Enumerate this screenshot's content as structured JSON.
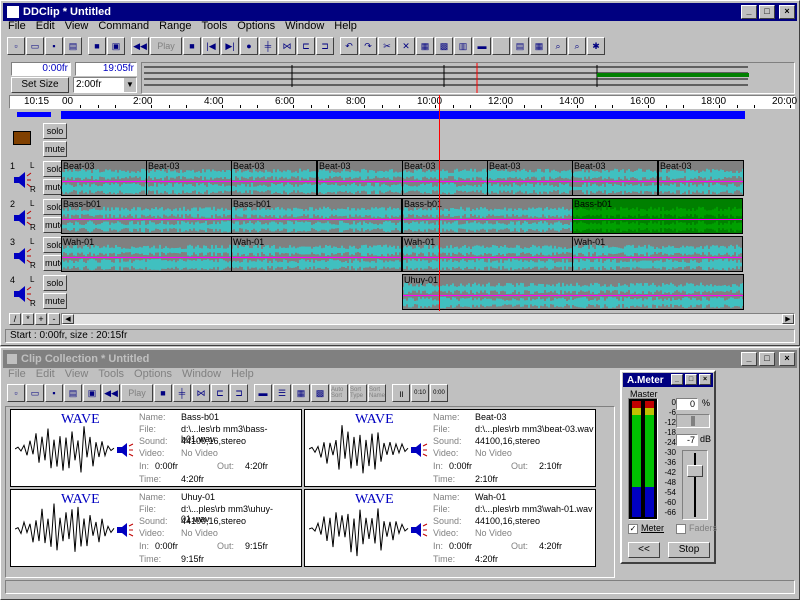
{
  "main": {
    "title": "DDClip * Untitled",
    "menus": [
      "File",
      "Edit",
      "View",
      "Command",
      "Range",
      "Tools",
      "Options",
      "Window",
      "Help"
    ],
    "play_label": "Play",
    "pos_start": "0:00fr",
    "pos_end": "19:05fr",
    "set_size_label": "Set Size",
    "size_value": "2:00fr",
    "current_time": "10:15",
    "ruler_ticks": [
      "00",
      "2:00",
      "4:00",
      "6:00",
      "8:00",
      "10:00",
      "12:00",
      "14:00",
      "16:00",
      "18:00",
      "20:00"
    ],
    "tracks": [
      {
        "num": "1",
        "solo": "solo",
        "mute": "mute",
        "clips": [
          "Beat-03",
          "Beat-03",
          "Beat-03",
          "Beat-03",
          "Beat-03",
          "Beat-03",
          "Beat-03",
          "Beat-03"
        ]
      },
      {
        "num": "2",
        "solo": "solo",
        "mute": "mute",
        "clips": [
          "Bass-b01",
          "Bass-b01",
          "Bass-b01",
          "Bass-b01"
        ]
      },
      {
        "num": "3",
        "solo": "solo",
        "mute": "mute",
        "clips": [
          "Wah-01",
          "Wah-01",
          "Wah-01",
          "Wah-01"
        ]
      },
      {
        "num": "4",
        "solo": "solo",
        "mute": "mute",
        "clips": [
          "Uhuy-01"
        ]
      }
    ],
    "video_track": {
      "solo": "solo",
      "mute": "mute"
    },
    "status": "Start : 0:00fr,  size : 20:15fr"
  },
  "collection": {
    "title": "Clip Collection * Untitled",
    "menus": [
      "File",
      "Edit",
      "View",
      "Tools",
      "Options",
      "Window",
      "Help"
    ],
    "play_label": "Play",
    "sort_labels": [
      "Auto Sort",
      "Sort Type",
      "Sort Name"
    ],
    "view_labels": [
      "0:10",
      "0:00"
    ],
    "field_labels": {
      "name": "Name:",
      "file": "File:",
      "sound": "Sound:",
      "video": "Video:",
      "in": "In:",
      "out": "Out:",
      "time": "Time:"
    },
    "wave_label": "WAVE",
    "clips": [
      {
        "name": "Bass-b01",
        "file": "d:\\...les\\rb mm3\\bass-b01.wav",
        "sound": "44100,16,stereo",
        "video": "No Video",
        "in": "0:00fr",
        "out": "4:20fr",
        "time": "4:20fr"
      },
      {
        "name": "Beat-03",
        "file": "d:\\...ples\\rb mm3\\beat-03.wav",
        "sound": "44100,16,stereo",
        "video": "No Video",
        "in": "0:00fr",
        "out": "2:10fr",
        "time": "2:10fr"
      },
      {
        "name": "Uhuy-01",
        "file": "d:\\...ples\\rb mm3\\uhuy-01.wav",
        "sound": "44100,16,stereo",
        "video": "No Video",
        "in": "0:00fr",
        "out": "9:15fr",
        "time": "9:15fr"
      },
      {
        "name": "Wah-01",
        "file": "d:\\...ples\\rb mm3\\wah-01.wav",
        "sound": "44100,16,stereo",
        "video": "No Video",
        "in": "0:00fr",
        "out": "4:20fr",
        "time": "4:20fr"
      }
    ]
  },
  "ameter": {
    "title": "A.Meter",
    "master_label": "Master",
    "scale": [
      "0",
      "-6",
      "-12",
      "-18",
      "-24",
      "-30",
      "-36",
      "-42",
      "-48",
      "-54",
      "-60",
      "-66"
    ],
    "pan_value": "0",
    "pan_unit": "%",
    "gain_value": "-7",
    "gain_unit": "dB",
    "meter_label": "Meter",
    "meter_checked": true,
    "faders_label": "Faders",
    "faders_checked": false,
    "back_label": "<<",
    "stop_label": "Stop"
  },
  "colors": {
    "title_active": "#000080",
    "waveform": "#00ffff",
    "clip_bg": "#808080",
    "selected_clip": "#008000",
    "playhead": "#ff0000",
    "timeline_bar": "#0000ff"
  }
}
